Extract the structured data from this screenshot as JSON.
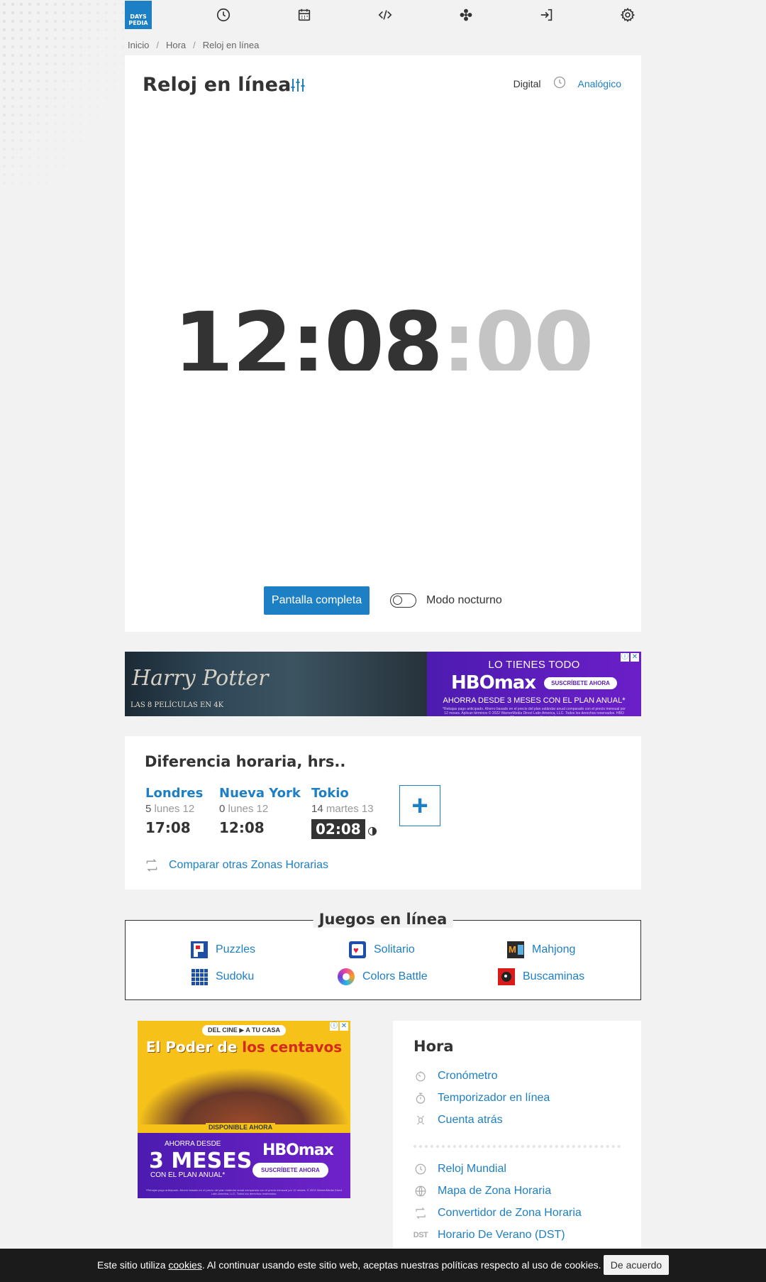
{
  "logo": {
    "line1": "DAYS",
    "line2": "PEDIA"
  },
  "nav": [
    "clock-icon",
    "calendar-icon",
    "code-icon",
    "games-icon",
    "login-icon",
    "gear-icon"
  ],
  "breadcrumb": {
    "items": [
      "Inicio",
      "Hora",
      "Reloj en línea"
    ],
    "separator": "/"
  },
  "clock": {
    "title": "Reloj en línea",
    "mode_digital": "Digital",
    "mode_analog": "Analógico",
    "hours_minutes": "12:08",
    "seconds": ":00",
    "fullscreen_label": "Pantalla completa",
    "night_mode_label": "Modo nocturno",
    "night_mode_on": false
  },
  "ad_top": {
    "left_title": "Harry Potter",
    "left_sub": "LAS 8 PELÍCULAS EN 4K",
    "right_line1": "LO TIENES TODO",
    "right_brand": "HBOmax",
    "right_cta": "SUSCRÍBETE AHORA",
    "right_line3": "AHORRA DESDE 3 MESES CON EL PLAN ANUAL*",
    "right_fine": "*Rebajas pago anticipado. Ahorro basado en el precio del plan estándar anual comparado con el precio mensual por 12 meses. Aplican términos © 2022 WarnerMedia Direct Latin America, LLC. Todos los derechos reservados. HBO Max es una marca licenciada."
  },
  "time_diff": {
    "title": "Diferencia horaria, hrs..",
    "cities": [
      {
        "name": "Londres",
        "offset": "5",
        "date": "lunes 12",
        "time": "17:08",
        "dark": false
      },
      {
        "name": "Nueva York",
        "offset": "0",
        "date": "lunes 12",
        "time": "12:08",
        "dark": false
      },
      {
        "name": "Tokio",
        "offset": "14",
        "date": "martes 13",
        "time": "02:08",
        "dark": true
      }
    ],
    "add_label": "+",
    "compare_label": "Comparar otras Zonas Horarias"
  },
  "games": {
    "title": "Juegos en línea",
    "items": [
      {
        "label": "Puzzles",
        "icon": "puzzle-icon"
      },
      {
        "label": "Solitario",
        "icon": "solitaire-icon"
      },
      {
        "label": "Mahjong",
        "icon": "mahjong-icon"
      },
      {
        "label": "Sudoku",
        "icon": "sudoku-icon"
      },
      {
        "label": "Colors Battle",
        "icon": "colors-battle-icon"
      },
      {
        "label": "Buscaminas",
        "icon": "minesweeper-icon"
      }
    ]
  },
  "ad_bottom": {
    "tag": "DEL CINE ▶ A TU CASA",
    "movie_a": "El Poder de ",
    "movie_b": "los centavos",
    "available": "DISPONIBLE AHORA",
    "save_from": "AHORRA DESDE",
    "months": "3 MESES",
    "plan": "CON EL PLAN ANUAL*",
    "brand": "HBOmax",
    "cta": "SUSCRÍBETE AHORA",
    "fine": "*Rebajas pago anticipado. Ahorro basado en el precio del plan estándar anual comparado con el precio mensual por 12 meses. © 2022 WarnerMedia Direct Latin America, LLC. Todos los derechos reservados."
  },
  "sidebar": {
    "title": "Hora",
    "group1": [
      {
        "label": "Cronómetro",
        "icon": "stopwatch-icon"
      },
      {
        "label": "Temporizador en línea",
        "icon": "timer-icon"
      },
      {
        "label": "Cuenta atrás",
        "icon": "countdown-icon"
      }
    ],
    "group2": [
      {
        "label": "Reloj Mundial",
        "icon": "clock-icon"
      },
      {
        "label": "Mapa de Zona Horaria",
        "icon": "globe-icon"
      },
      {
        "label": "Convertidor de Zona Horaria",
        "icon": "convert-icon"
      },
      {
        "label": "Horario De Verano (DST)",
        "icon": "dst-icon",
        "icon_text": "DST"
      }
    ]
  },
  "cookie": {
    "text_before": "Este sitio utiliza ",
    "link": "cookies",
    "text_after": ". Al continuar usando este sitio web, aceptas nuestras políticas respecto al uso de cookies.",
    "button": "De acuerdo"
  },
  "colors": {
    "accent": "#1d7fc4",
    "text": "#333333",
    "background": "#f2f2f2",
    "cookie_bar": "#1b1b1b"
  }
}
